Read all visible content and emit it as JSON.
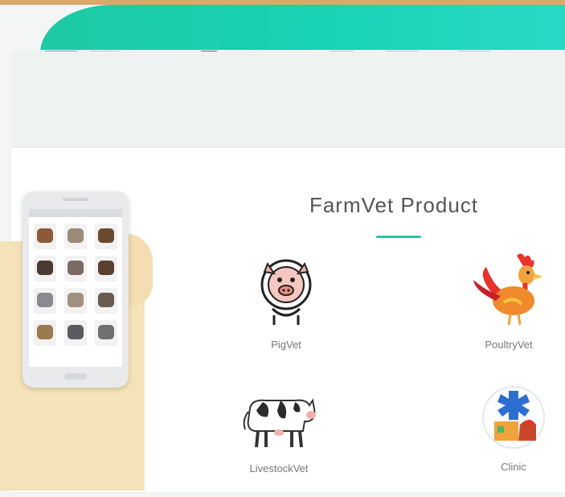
{
  "section": {
    "title": "FarmVet Product"
  },
  "products": [
    {
      "label": "PigVet",
      "icon": "pig-icon"
    },
    {
      "label": "PoultryVet",
      "icon": "rooster-icon"
    },
    {
      "label": "LivestockVet",
      "icon": "cow-icon"
    },
    {
      "label": "Clinic",
      "icon": "clinic-icon"
    }
  ],
  "colors": {
    "banner_start": "#1ec9a4",
    "banner_end": "#2ad9c9",
    "accent": "#2dc2a6",
    "page_bg": "#f4f6f5",
    "border_top": "#d9a96a"
  }
}
